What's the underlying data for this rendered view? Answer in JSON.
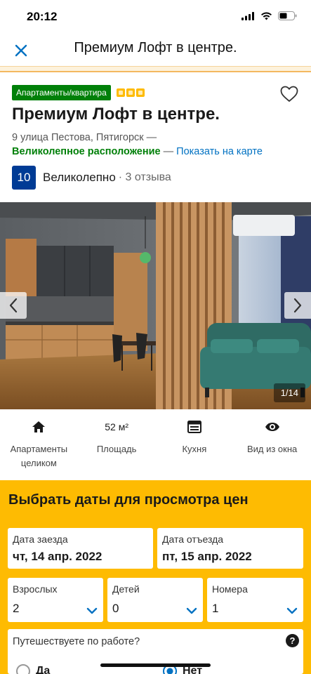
{
  "status_bar": {
    "time": "20:12"
  },
  "nav": {
    "title": "Премиум Лофт в центре."
  },
  "property": {
    "type_badge": "Апартаменты/квартира",
    "star_count": 3,
    "title": "Премиум Лофт в центре.",
    "address": "9 улица Пестова, Пятигорск —",
    "location_great": "Великолепное расположение",
    "location_dash": " — ",
    "show_on_map": "Показать на карте",
    "score": "10",
    "score_word": "Великолепно",
    "reviews": "· 3 отзыва"
  },
  "gallery": {
    "counter": "1/14"
  },
  "facilities": [
    {
      "icon": "home-icon",
      "value": "",
      "label": "Апартаменты целиком"
    },
    {
      "icon": "",
      "value": "52 м²",
      "label": "Площадь"
    },
    {
      "icon": "kitchen-icon",
      "value": "",
      "label": "Кухня"
    },
    {
      "icon": "eye-icon",
      "value": "",
      "label": "Вид из окна"
    }
  ],
  "booking": {
    "title": "Выбрать даты для просмотра цен",
    "checkin_label": "Дата заезда",
    "checkin_value": "чт, 14 апр. 2022",
    "checkout_label": "Дата отъезда",
    "checkout_value": "пт, 15 апр. 2022",
    "adults_label": "Взрослых",
    "adults_value": "2",
    "children_label": "Детей",
    "children_value": "0",
    "rooms_label": "Номера",
    "rooms_value": "1",
    "work_question": "Путешествуете по работе?",
    "help": "?",
    "yes": "Да",
    "no": "Нет",
    "selected": "no"
  },
  "colors": {
    "brand_blue": "#003b95",
    "link_blue": "#0071c2",
    "green": "#008009",
    "yellow": "#febb02"
  }
}
